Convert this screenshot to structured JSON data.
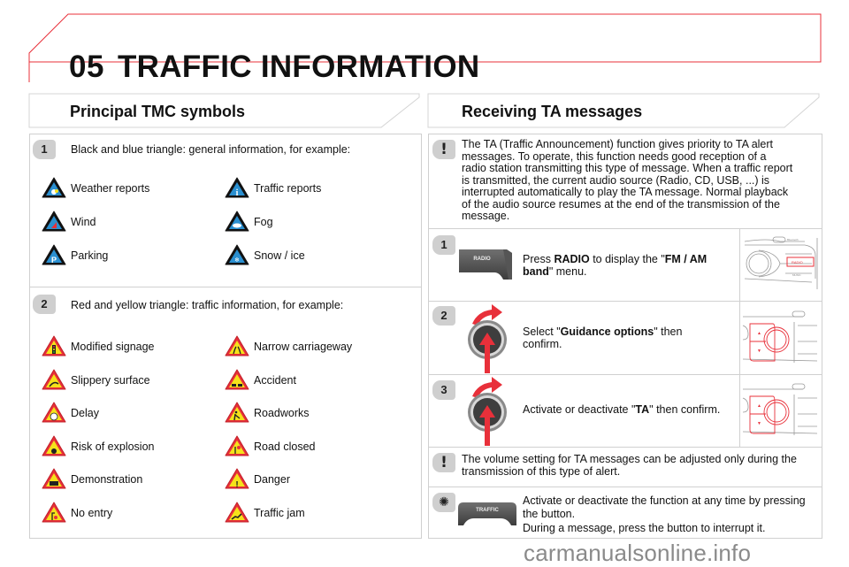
{
  "header": {
    "chapter_number": "05",
    "title": "TRAFFIC INFORMATION"
  },
  "colors": {
    "accent_red": "#e8303a",
    "border_gray": "#d0d0d0",
    "badge_gray": "#cfcfcf",
    "info_blue": "#2a8fd0",
    "warning_yellow": "#f5e21a",
    "warning_red": "#e8303a"
  },
  "left": {
    "title": "Principal TMC symbols",
    "group1": {
      "badge": "1",
      "intro": "Black and blue triangle: general information, for example:",
      "symbols": [
        {
          "label": "Weather reports",
          "icon": "weather-icon"
        },
        {
          "label": "Traffic reports",
          "icon": "info-icon"
        },
        {
          "label": "Wind",
          "icon": "wind-icon"
        },
        {
          "label": "Fog",
          "icon": "fog-icon"
        },
        {
          "label": "Parking",
          "icon": "parking-icon"
        },
        {
          "label": "Snow / ice",
          "icon": "snowflake-icon"
        }
      ]
    },
    "group2": {
      "badge": "2",
      "intro": "Red and yellow triangle: traffic information, for example:",
      "symbols": [
        {
          "label": "Modified signage",
          "icon": "traffic-light-icon"
        },
        {
          "label": "Narrow carriageway",
          "icon": "narrow-road-icon"
        },
        {
          "label": "Slippery surface",
          "icon": "slippery-icon"
        },
        {
          "label": "Accident",
          "icon": "accident-icon"
        },
        {
          "label": "Delay",
          "icon": "clock-icon"
        },
        {
          "label": "Roadworks",
          "icon": "roadworks-icon"
        },
        {
          "label": "Risk of explosion",
          "icon": "explosion-icon"
        },
        {
          "label": "Road closed",
          "icon": "road-closed-icon"
        },
        {
          "label": "Demonstration",
          "icon": "demonstration-icon"
        },
        {
          "label": "Danger",
          "icon": "exclamation-icon"
        },
        {
          "label": "No entry",
          "icon": "no-entry-icon"
        },
        {
          "label": "Traffic jam",
          "icon": "traffic-jam-icon"
        }
      ]
    }
  },
  "right": {
    "title": "Receiving TA messages",
    "intro_badge": "!",
    "intro_lines": [
      "The TA (Traffic Announcement) function gives priority to TA alert",
      "messages. To operate, this function needs good reception of a",
      "radio station transmitting this type of message. When a traffic report",
      "is transmitted, the current audio source (Radio, CD, USB, ...) is",
      "interrupted automatically to play the TA message. Normal playback",
      "of the audio source resumes at the end of the transmission of the",
      "message."
    ],
    "steps": [
      {
        "badge": "1",
        "button_label": "RADIO",
        "pre": "Press ",
        "bold1": "RADIO",
        "mid": " to display the \"",
        "bold2": "FM / AM",
        "line2_bold": "band",
        "post": "\" menu."
      },
      {
        "badge": "2",
        "pre": "Select \"",
        "bold": "Guidance options",
        "post": "\" then",
        "line2": "confirm."
      },
      {
        "badge": "3",
        "pre": "Activate or deactivate \"",
        "bold": "TA",
        "post": "\" then confirm."
      }
    ],
    "note_badge": "!",
    "note_lines": [
      "The volume setting for TA messages can be adjusted only during the",
      "transmission of this type of alert."
    ],
    "traffic": {
      "button_label": "TRAFFIC",
      "line1": "Activate or deactivate the function at any time by pressing",
      "line2": "the button.",
      "line3": "During a message, press the button to interrupt it."
    },
    "panel_labels": {
      "radio": "RADIO",
      "music": "MUSIC",
      "bluetooth": "Bluetooth"
    }
  },
  "watermark": "carmanualsonline.info"
}
